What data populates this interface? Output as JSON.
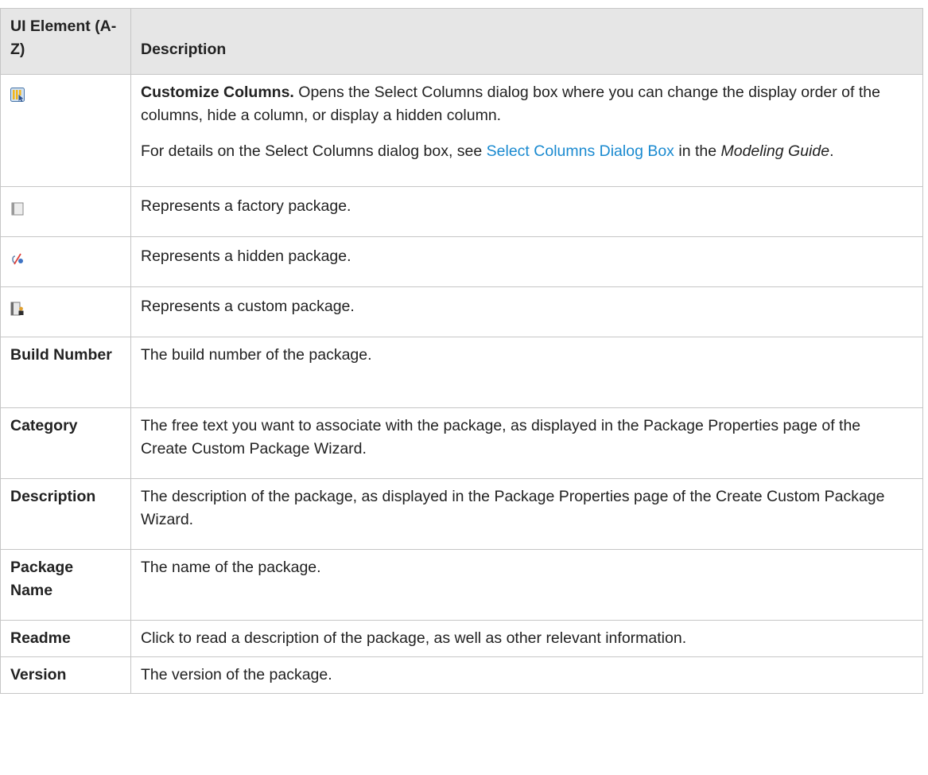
{
  "header": {
    "col1": "UI Element (A-Z)",
    "col2": "Description"
  },
  "rows": {
    "customize": {
      "icon": "customize-columns-icon",
      "lead": "Customize Columns.",
      "text": " Opens the Select Columns dialog box where you can change the display order of the columns, hide a column, or display a hidden column.",
      "p2_before": "For details on the Select Columns dialog box, see ",
      "p2_link": "Select Columns Dialog Box",
      "p2_middle": " in the ",
      "p2_italic": "Modeling Guide",
      "p2_after": "."
    },
    "factory": {
      "icon": "factory-package-icon",
      "desc": "Represents a factory package."
    },
    "hidden": {
      "icon": "hidden-package-icon",
      "desc": "Represents a hidden package."
    },
    "custom": {
      "icon": "custom-package-icon",
      "desc": "Represents a custom package."
    },
    "build": {
      "name": "Build Number",
      "desc": "The build number of the package."
    },
    "category": {
      "name": "Category",
      "desc": "The free text you want to associate with the package, as displayed in the Package Properties page of the Create Custom Package Wizard."
    },
    "description": {
      "name": "Description",
      "desc": "The description of the package, as displayed in the Package Properties page of the Create Custom Package Wizard."
    },
    "package_name": {
      "name": "Package Name",
      "desc": "The name of the package."
    },
    "readme": {
      "name": "Readme",
      "desc": "Click to read a description of the package, as well as other relevant information."
    },
    "version": {
      "name": "Version",
      "desc": "The version of the package."
    }
  }
}
